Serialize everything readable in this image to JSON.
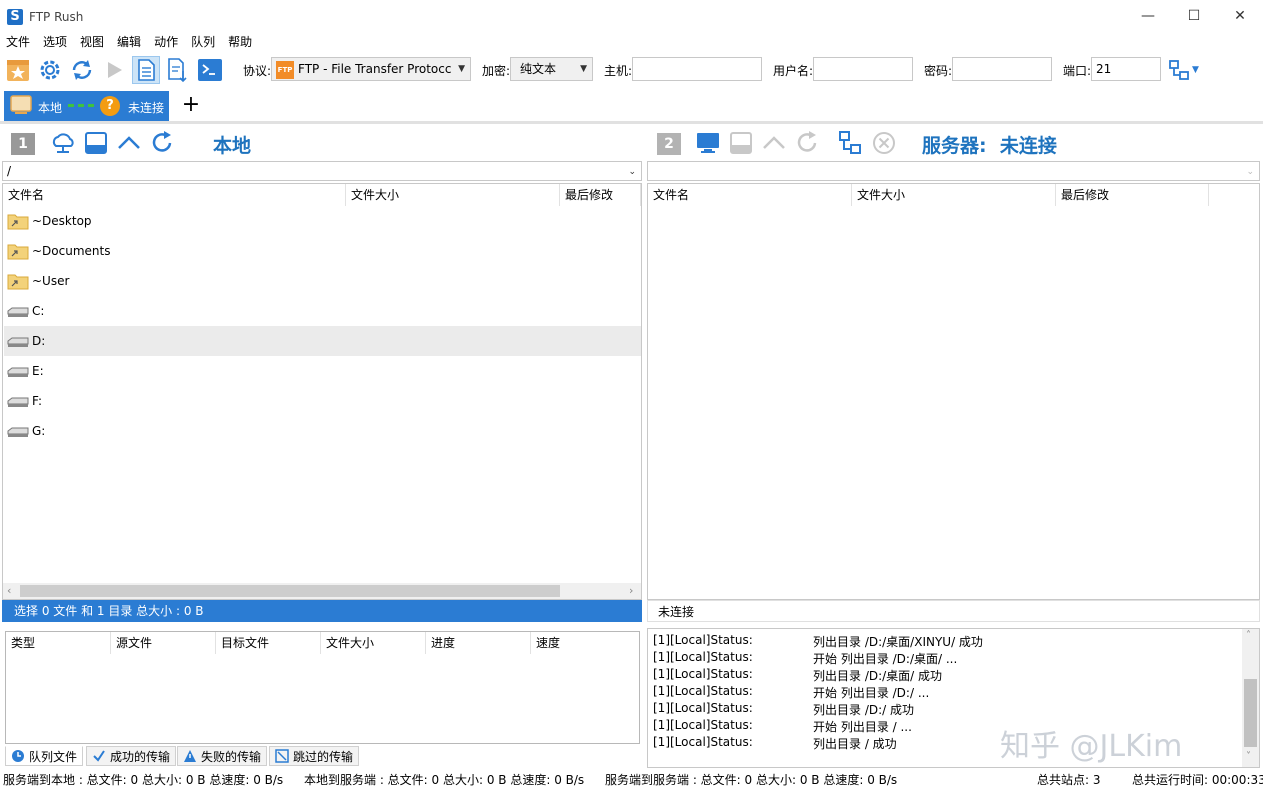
{
  "window": {
    "title": "FTP Rush"
  },
  "menu": [
    "文件",
    "选项",
    "视图",
    "编辑",
    "动作",
    "队列",
    "帮助"
  ],
  "toolbar": {
    "protocol_label": "协议:",
    "protocol_value": "FTP - File Transfer Protocc",
    "protocol_badge": "FTP",
    "encryption_label": "加密:",
    "encryption_value": "纯文本",
    "host_label": "主机:",
    "host_value": "",
    "user_label": "用户名:",
    "user_value": "",
    "password_label": "密码:",
    "password_value": "",
    "port_label": "端口:",
    "port_value": "21"
  },
  "tabs": {
    "local_label": "本地",
    "remote_label": "未连接",
    "add": "+"
  },
  "local": {
    "number": "1",
    "title": "本地",
    "path": "/",
    "columns": [
      "文件名",
      "文件大小",
      "最后修改"
    ],
    "items": [
      {
        "name": "~Desktop",
        "type": "folder"
      },
      {
        "name": "~Documents",
        "type": "folder"
      },
      {
        "name": "~User",
        "type": "folder"
      },
      {
        "name": "C:",
        "type": "drive"
      },
      {
        "name": "D:",
        "type": "drive"
      },
      {
        "name": "E:",
        "type": "drive"
      },
      {
        "name": "F:",
        "type": "drive"
      },
      {
        "name": "G:",
        "type": "drive"
      }
    ],
    "status": "选择 0 文件 和 1 目录 总大小 : 0 B"
  },
  "remote": {
    "number": "2",
    "title": "服务器:  未连接",
    "path": "",
    "columns": [
      "文件名",
      "文件大小",
      "最后修改"
    ],
    "status": "未连接"
  },
  "queue": {
    "columns": [
      "类型",
      "源文件",
      "目标文件",
      "文件大小",
      "进度",
      "速度"
    ],
    "tabs": [
      "队列文件",
      "成功的传输",
      "失败的传输",
      "跳过的传输"
    ]
  },
  "log": [
    {
      "src": "[1][Local]Status:",
      "msg": "列出目录 /D:/桌面/XINYU/ 成功"
    },
    {
      "src": "[1][Local]Status:",
      "msg": "开始 列出目录 /D:/桌面/ ..."
    },
    {
      "src": "[1][Local]Status:",
      "msg": "列出目录 /D:/桌面/ 成功"
    },
    {
      "src": "[1][Local]Status:",
      "msg": "开始 列出目录 /D:/ ..."
    },
    {
      "src": "[1][Local]Status:",
      "msg": "列出目录 /D:/ 成功"
    },
    {
      "src": "[1][Local]Status:",
      "msg": "开始 列出目录 / ..."
    },
    {
      "src": "[1][Local]Status:",
      "msg": "列出目录 / 成功"
    }
  ],
  "watermark": "知乎 @JLKim",
  "footer": {
    "server_to_local": "服务端到本地 : 总文件: 0  总大小: 0 B  总速度: 0 B/s",
    "local_to_server": "本地到服务端 : 总文件: 0  总大小: 0 B  总速度: 0 B/s",
    "server_to_server": "服务端到服务端 : 总文件: 0  总大小: 0 B  总速度: 0 B/s",
    "total_sites": "总共站点: 3",
    "uptime": "总共运行时间: 00:00:33"
  },
  "colors": {
    "accent": "#1e73be",
    "tab_active": "#2b7cd3",
    "status_bar": "#2b7cd3"
  }
}
